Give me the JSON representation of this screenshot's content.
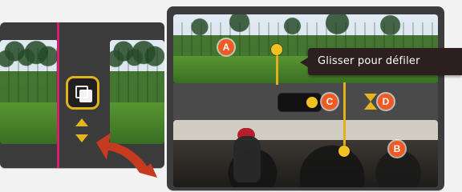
{
  "tooltip": {
    "text": "Glisser pour défiler"
  },
  "labels": {
    "a": "A",
    "b": "B",
    "c": "C",
    "d": "D"
  },
  "icons": {
    "overlay": "overlay-icon",
    "up_down": "up-down-icon",
    "pointer_arrow": "curved-pointer-arrow-icon",
    "range_arrows": "range-arrows-icon"
  },
  "colors": {
    "playhead_pink": "#d21e6c",
    "accent_yellow": "#e2b11a",
    "badge_orange": "#f15a22",
    "tooltip_bg": "#2b1f1f",
    "pointer_red": "#c63a1f"
  }
}
